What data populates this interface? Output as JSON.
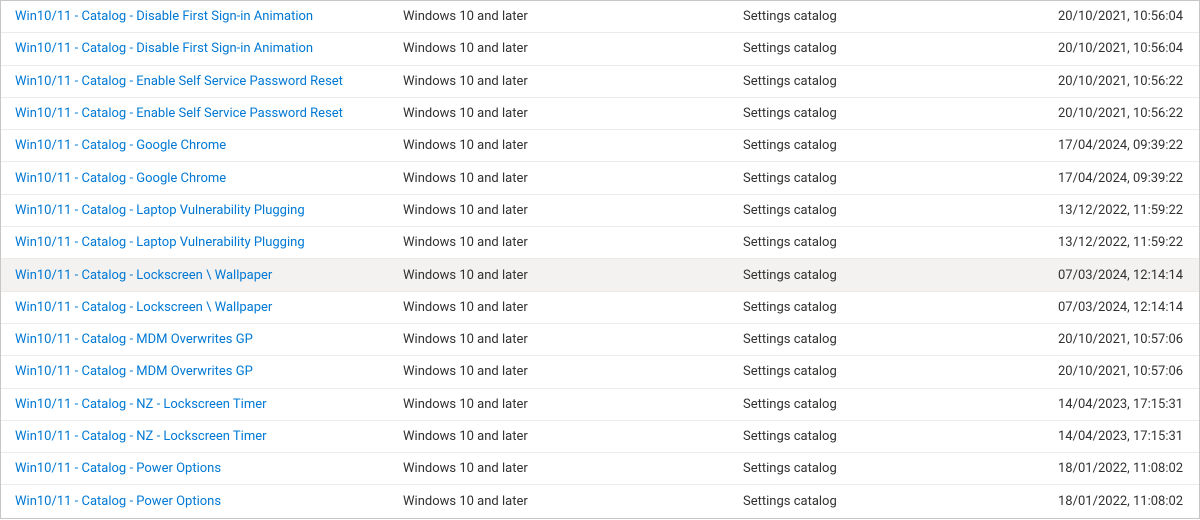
{
  "profiles": [
    {
      "name": "Win10/11 - Catalog - Disable First Sign-in Animation",
      "platform": "Windows 10 and later",
      "type": "Settings catalog",
      "modified": "20/10/2021, 10:56:04",
      "hovered": false
    },
    {
      "name": "Win10/11 - Catalog - Disable First Sign-in Animation",
      "platform": "Windows 10 and later",
      "type": "Settings catalog",
      "modified": "20/10/2021, 10:56:04",
      "hovered": false
    },
    {
      "name": "Win10/11 - Catalog - Enable Self Service Password Reset",
      "platform": "Windows 10 and later",
      "type": "Settings catalog",
      "modified": "20/10/2021, 10:56:22",
      "hovered": false
    },
    {
      "name": "Win10/11 - Catalog - Enable Self Service Password Reset",
      "platform": "Windows 10 and later",
      "type": "Settings catalog",
      "modified": "20/10/2021, 10:56:22",
      "hovered": false
    },
    {
      "name": "Win10/11 - Catalog - Google Chrome",
      "platform": "Windows 10 and later",
      "type": "Settings catalog",
      "modified": "17/04/2024, 09:39:22",
      "hovered": false
    },
    {
      "name": "Win10/11 - Catalog - Google Chrome",
      "platform": "Windows 10 and later",
      "type": "Settings catalog",
      "modified": "17/04/2024, 09:39:22",
      "hovered": false
    },
    {
      "name": "Win10/11 - Catalog - Laptop Vulnerability Plugging",
      "platform": "Windows 10 and later",
      "type": "Settings catalog",
      "modified": "13/12/2022, 11:59:22",
      "hovered": false
    },
    {
      "name": "Win10/11 - Catalog - Laptop Vulnerability Plugging",
      "platform": "Windows 10 and later",
      "type": "Settings catalog",
      "modified": "13/12/2022, 11:59:22",
      "hovered": false
    },
    {
      "name": "Win10/11 - Catalog - Lockscreen \\ Wallpaper",
      "platform": "Windows 10 and later",
      "type": "Settings catalog",
      "modified": "07/03/2024, 12:14:14",
      "hovered": true
    },
    {
      "name": "Win10/11 - Catalog - Lockscreen \\ Wallpaper",
      "platform": "Windows 10 and later",
      "type": "Settings catalog",
      "modified": "07/03/2024, 12:14:14",
      "hovered": false
    },
    {
      "name": "Win10/11 - Catalog - MDM Overwrites GP",
      "platform": "Windows 10 and later",
      "type": "Settings catalog",
      "modified": "20/10/2021, 10:57:06",
      "hovered": false
    },
    {
      "name": "Win10/11 - Catalog - MDM Overwrites GP",
      "platform": "Windows 10 and later",
      "type": "Settings catalog",
      "modified": "20/10/2021, 10:57:06",
      "hovered": false
    },
    {
      "name": "Win10/11 - Catalog - NZ - Lockscreen Timer",
      "platform": "Windows 10 and later",
      "type": "Settings catalog",
      "modified": "14/04/2023, 17:15:31",
      "hovered": false
    },
    {
      "name": "Win10/11 - Catalog - NZ - Lockscreen Timer",
      "platform": "Windows 10 and later",
      "type": "Settings catalog",
      "modified": "14/04/2023, 17:15:31",
      "hovered": false
    },
    {
      "name": "Win10/11 - Catalog - Power Options",
      "platform": "Windows 10 and later",
      "type": "Settings catalog",
      "modified": "18/01/2022, 11:08:02",
      "hovered": false
    },
    {
      "name": "Win10/11 - Catalog - Power Options",
      "platform": "Windows 10 and later",
      "type": "Settings catalog",
      "modified": "18/01/2022, 11:08:02",
      "hovered": false
    }
  ]
}
